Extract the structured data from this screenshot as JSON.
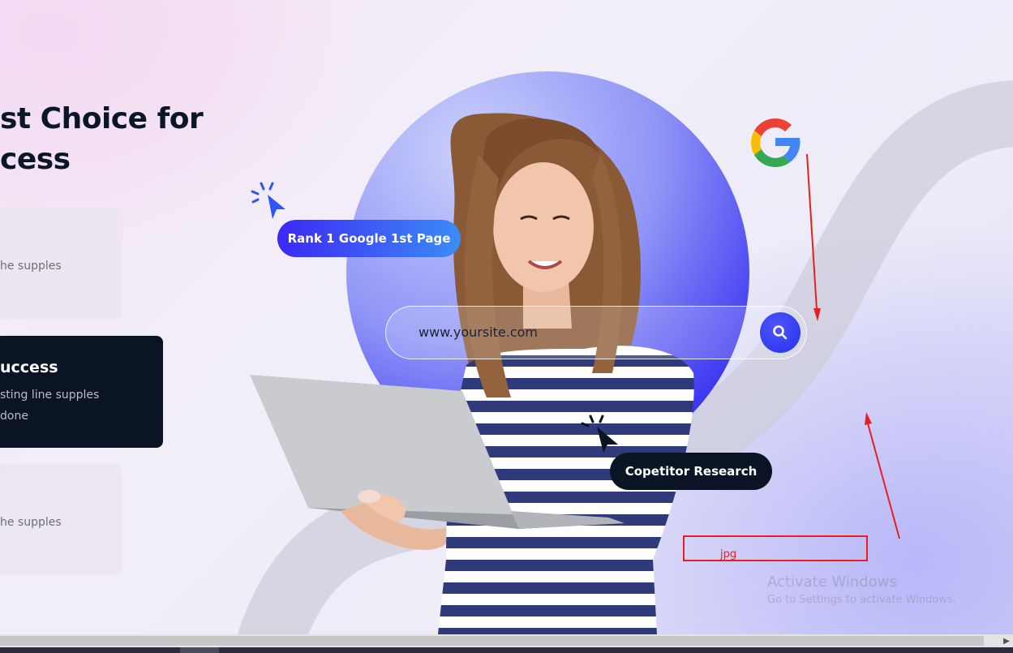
{
  "hero": {
    "headline_line1": "st Choice for",
    "headline_line2": "cess"
  },
  "cards": [
    {
      "text": "he supples"
    },
    {
      "title": "uccess",
      "line1": "sting line supples",
      "line2": "done"
    },
    {
      "text": "he supples"
    }
  ],
  "badges": {
    "rank": "Rank 1 Google 1st Page",
    "competitor": "Copetitor Research"
  },
  "search": {
    "value": "www.yoursite.com"
  },
  "annotation": {
    "label": "jpg"
  },
  "watermark": {
    "line1": "Activate Windows",
    "line2": "Go to Settings to activate Windows."
  },
  "icons": {
    "google": "google-logo-icon",
    "search": "magnifier-icon",
    "cursor": "click-cursor-icon"
  },
  "colors": {
    "dark": "#0b1424",
    "accent_start": "#3c28f5",
    "accent_end": "#3b8cf6",
    "circle": "#3c37f2",
    "annotation_red": "#e81f1f"
  }
}
